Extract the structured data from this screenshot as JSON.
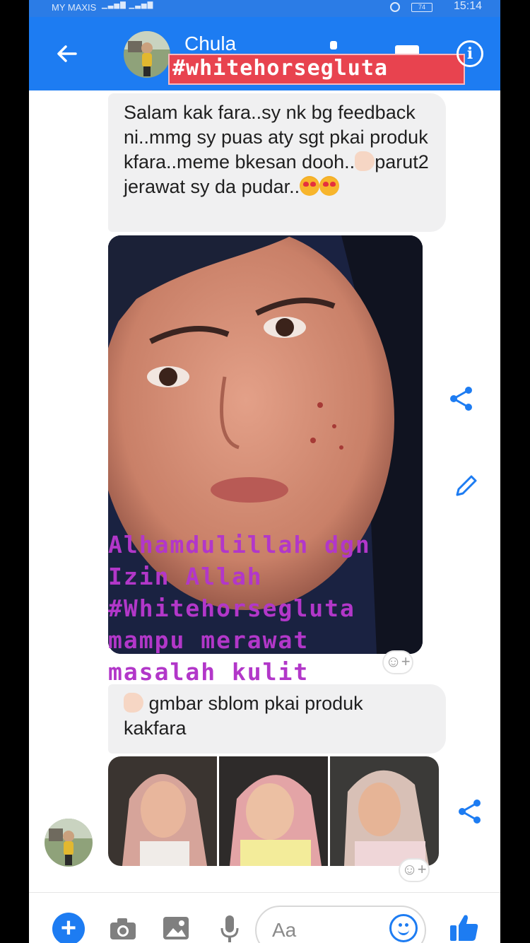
{
  "status_bar": {
    "carrier": "MY MAXIS",
    "battery": "74",
    "time": "15:14"
  },
  "header": {
    "contact_name": "Chula",
    "hashtag": "#whitehorsegluta",
    "info_label": "i"
  },
  "messages": {
    "first": "Salam kak fara..sy nk bg feedback ni..mmg sy puas aty sgt pkai produk kfara..meme bkesan dooh..",
    "first_tail_a": "parut2 jerawat sy da pudar..",
    "photo_caption": [
      "Alhamdulillah dgn",
      "Izin Allah",
      "#Whitehorsegluta",
      "mampu merawat",
      "masalah kulit"
    ],
    "second": "gmbar sblom pkai produk kakfara",
    "react_label": "☺+"
  },
  "composer": {
    "plus_label": "+",
    "placeholder": "Aa"
  },
  "colors": {
    "messenger_blue": "#1d7cf2",
    "bubble_gray": "#f0f0f1",
    "hashtag_red": "#e8434f",
    "overlay_purple": "#b237c9"
  },
  "icons": {
    "back": "arrow-left-icon",
    "call": "phone-icon",
    "video": "video-camera-icon",
    "info": "info-icon",
    "share": "share-icon",
    "edit": "pencil-icon",
    "camera": "camera-icon",
    "gallery": "image-icon",
    "mic": "microphone-icon",
    "emoji": "smiley-icon",
    "like": "thumbs-up-icon"
  }
}
